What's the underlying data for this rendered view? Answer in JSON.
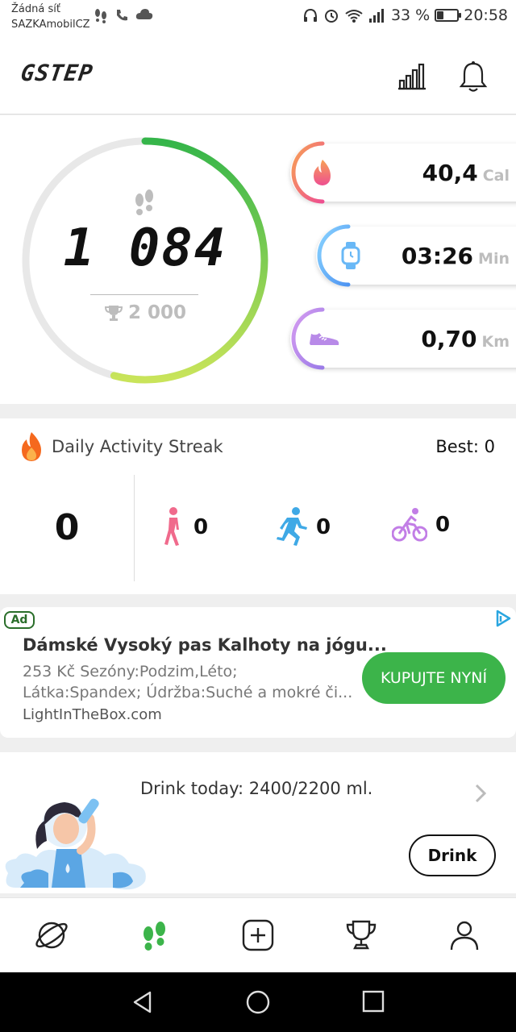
{
  "status_bar": {
    "carrier_line1": "Žádná síť",
    "carrier_line2": "SAZKAmobilCZ",
    "battery_text": "33 %",
    "battery_level": 0.33,
    "time": "20:58",
    "icons": [
      "footsteps-icon",
      "phone-icon",
      "cloud-icon",
      "headphones-icon",
      "alarm-icon",
      "wifi-icon",
      "signal-icon",
      "battery-icon"
    ]
  },
  "header": {
    "logo": "GSTEP",
    "icons": [
      "stats-bars-icon",
      "bell-icon"
    ]
  },
  "progress": {
    "steps": "1 084",
    "goal": "2 000",
    "fraction": 0.542,
    "colors": {
      "ring_bg": "#e8e8e8",
      "ring_start": "#c9e45a",
      "ring_end": "#35b54a"
    }
  },
  "stats": [
    {
      "value": "40,4",
      "unit": "Cal",
      "icon": "flame-icon",
      "color": "#f06a8c"
    },
    {
      "value": "03:26",
      "unit": "Min",
      "icon": "watch-icon",
      "color": "#69b8f6"
    },
    {
      "value": "0,70",
      "unit": "Km",
      "icon": "shoe-icon",
      "color": "#b88ae8"
    }
  ],
  "streak": {
    "title": "Daily Activity Streak",
    "best_label": "Best",
    "best_value": "0",
    "count": "0",
    "walk": "0",
    "run": "0",
    "bike": "0"
  },
  "ad": {
    "badge": "Ad",
    "title": "Dámské Vysoký pas Kalhoty na jógu...",
    "desc1": "253 Kč Sezóny:Podzim,Léto;",
    "desc2": "Látka:Spandex; Údržba:Suché a mokré či...",
    "source": "LightInTheBox.com",
    "cta": "KUPUJTE NYNÍ"
  },
  "drink": {
    "label": "Drink today",
    "amount": "2400/2200 ml.",
    "button": "Drink"
  },
  "nav": {
    "items": [
      "planet-icon",
      "footsteps-icon",
      "plus-icon",
      "trophy-icon",
      "person-icon"
    ],
    "active_color": "#3cb44a"
  },
  "system_nav": [
    "back-icon",
    "home-icon",
    "recents-icon"
  ]
}
